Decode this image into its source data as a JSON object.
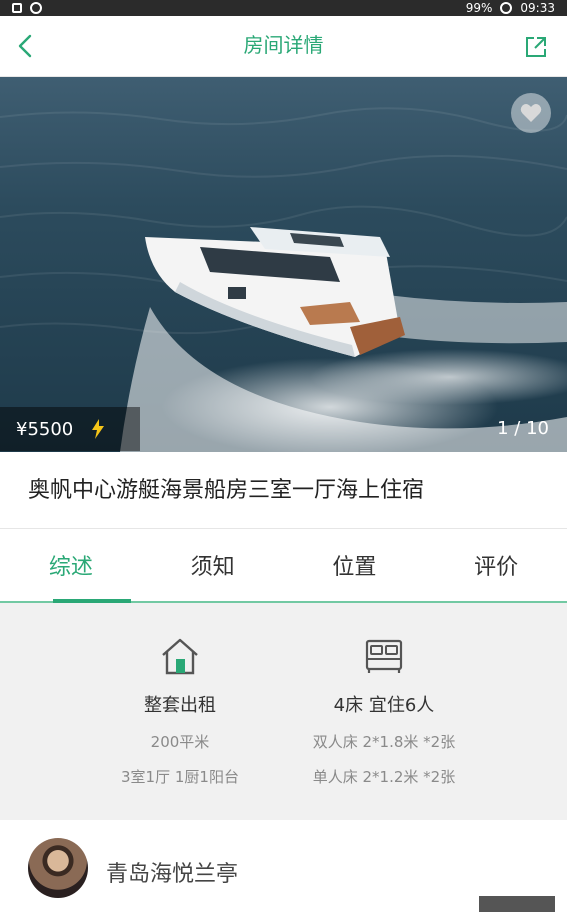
{
  "status_bar": {
    "battery_text": "99%",
    "time": "09:33"
  },
  "header": {
    "title": "房间详情",
    "back_icon": "chevron-left-icon",
    "share_icon": "share-icon"
  },
  "gallery": {
    "price": "¥5500",
    "flash_icon": "lightning-icon",
    "page_indicator": "1 / 10",
    "favorite_icon": "heart-icon"
  },
  "listing": {
    "title": "奥帆中心游艇海景船房三室一厅海上住宿"
  },
  "tabs": [
    {
      "label": "综述",
      "active": true
    },
    {
      "label": "须知",
      "active": false
    },
    {
      "label": "位置",
      "active": false
    },
    {
      "label": "评价",
      "active": false
    }
  ],
  "overview": {
    "rental": {
      "icon": "house-icon",
      "title": "整套出租",
      "area": "200平米",
      "layout": "3室1厅 1厨1阳台"
    },
    "beds": {
      "icon": "bed-icon",
      "title": "4床 宜住6人",
      "double": "双人床 2*1.8米 *2张",
      "single": "单人床 2*1.2米 *2张"
    }
  },
  "host": {
    "name": "青岛海悦兰亭"
  },
  "colors": {
    "accent": "#2aa876",
    "tab_underline": "#72c9a3"
  }
}
